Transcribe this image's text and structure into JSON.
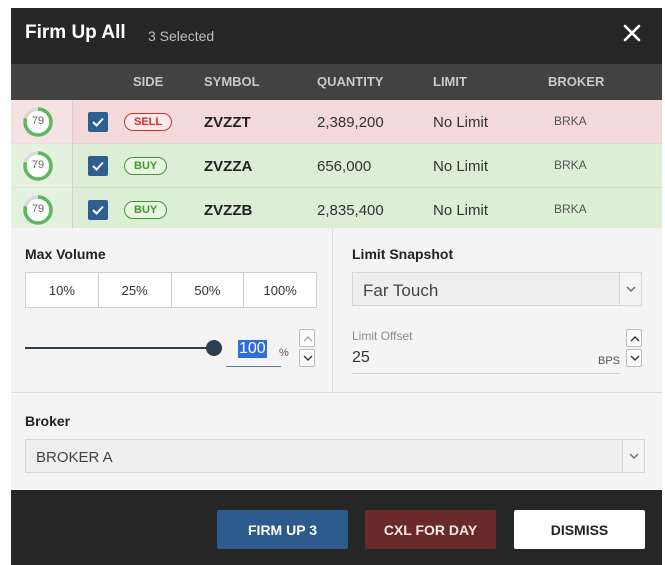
{
  "header": {
    "title": "Firm Up All",
    "subtitle": "3 Selected"
  },
  "columns": {
    "side": "SIDE",
    "symbol": "SYMBOL",
    "quantity": "QUANTITY",
    "limit": "LIMIT",
    "broker": "BROKER"
  },
  "orders": [
    {
      "score": "79",
      "score_fraction": 0.79,
      "checked": true,
      "side": "SELL",
      "symbol": "ZVZZT",
      "quantity": "2,389,200",
      "limit": "No Limit",
      "broker": "BRKA"
    },
    {
      "score": "79",
      "score_fraction": 0.79,
      "checked": true,
      "side": "BUY",
      "symbol": "ZVZZA",
      "quantity": "656,000",
      "limit": "No Limit",
      "broker": "BRKA"
    },
    {
      "score": "79",
      "score_fraction": 0.79,
      "checked": true,
      "side": "BUY",
      "symbol": "ZVZZB",
      "quantity": "2,835,400",
      "limit": "No Limit",
      "broker": "BRKA"
    }
  ],
  "max_volume": {
    "title": "Max Volume",
    "presets": [
      "10%",
      "25%",
      "50%",
      "100%"
    ],
    "value": "100",
    "unit": "%",
    "slider_fraction": 1.0
  },
  "limit_snapshot": {
    "title": "Limit Snapshot",
    "selected": "Far Touch",
    "offset_label": "Limit Offset",
    "offset_value": "25",
    "offset_unit": "BPS"
  },
  "broker": {
    "title": "Broker",
    "selected": "BROKER A"
  },
  "footer": {
    "firm_up": "FIRM UP 3",
    "cxl_for_day": "CXL FOR DAY",
    "dismiss": "DISMISS"
  },
  "colors": {
    "sell": "#d0312d",
    "buy": "#3d9a2b",
    "ring": "#5cb85c",
    "checkbox": "#2f5f8e",
    "primary": "#2d5a8c",
    "danger": "#6a2a2a"
  },
  "icons": {
    "close": "close-icon",
    "check": "check-icon",
    "chevron": "chevron-down-icon"
  }
}
